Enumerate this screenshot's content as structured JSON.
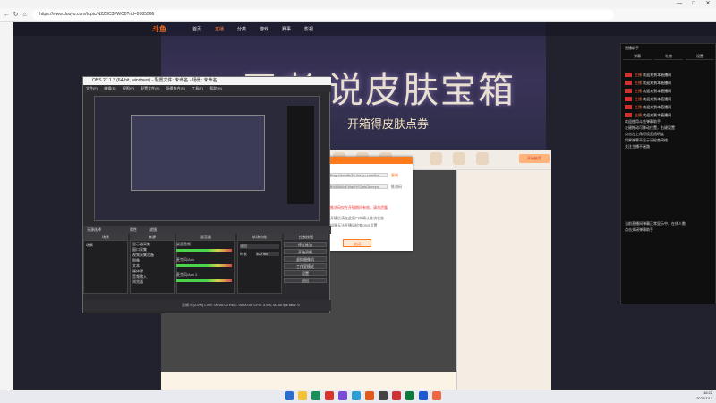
{
  "browser": {
    "url": "https://www.douyu.com/topic/N2Z3C3FWC0?rid=9985566",
    "window_controls": [
      "—",
      "□",
      "✕"
    ],
    "nav_icons": [
      "back-icon",
      "refresh-icon",
      "home-icon"
    ]
  },
  "site": {
    "logo": "斗鱼",
    "nav": [
      "首页",
      "直播",
      "分类",
      "游戏",
      "赛事",
      "影视"
    ],
    "hero_title": "王者 说皮肤宝箱",
    "hero_subtitle": "开箱得皮肤点券",
    "orange_button": "开始抽奖"
  },
  "dialog": {
    "lines": [
      "rtmp://sendtc3a.douyu.com/live",
      "9985566rEI9aMVS3ekDkmrzo",
      "推流码",
      "复制"
    ],
    "warning": "推流码仅在开播期间有效，请勿泄露",
    "note1": "开播后请在此窗口中确认推流状态",
    "note2": "如果无法开播请检查OBS设置",
    "button": "关闭"
  },
  "obs": {
    "title": "OBS 27.1.3 (64-bit, windows) - 配置文件: 未命名 - 场景: 未命名",
    "menu": [
      "文件(F)",
      "编辑(E)",
      "视图(V)",
      "配置文件(P)",
      "场景集合(S)",
      "工具(T)",
      "帮助(H)"
    ],
    "tabs": [
      "无源选择",
      "属性",
      "滤镜"
    ],
    "panes": [
      "场景",
      "来源",
      "混音器",
      "转场特效",
      "控制按钮"
    ],
    "scene": "场景",
    "sources": [
      "显示器采集",
      "窗口采集",
      "视频采集设备",
      "图像",
      "文本",
      "媒体源",
      "音频输入",
      "浏览器"
    ],
    "mixer": [
      "桌面音频",
      "麦克风/Aux",
      "麦克风/Aux 2"
    ],
    "transition": [
      "淡出",
      "时长",
      "300 ms"
    ],
    "controls": [
      "停止推流",
      "开始录制",
      "虚拟摄像机",
      "工作室模式",
      "设置",
      "退出"
    ],
    "status": "丢帧 0 (0.0%)   LIVE: 00:00:00   REC: 00:00:00   CPU: 3.9%, 60.00 fps   kb/s: 0"
  },
  "overlay": {
    "title": "直播助手",
    "tabs": [
      "弹幕",
      "礼物",
      "设置"
    ],
    "messages": [
      {
        "name": "主播",
        "text": "欢迎来到本直播间"
      },
      {
        "name": "主播",
        "text": "欢迎来到本直播间"
      },
      {
        "name": "主播",
        "text": "欢迎来到本直播间"
      },
      {
        "name": "主播",
        "text": "欢迎来到本直播间"
      },
      {
        "name": "主播",
        "text": "欢迎来到本直播间"
      },
      {
        "name": "主播",
        "text": "欢迎来到本直播间"
      }
    ],
    "notes": [
      "欢迎使用斗鱼弹幕助手",
      "左键拖动可移动位置，右键设置",
      "点击左上角可设置透明度",
      "如果弹幕不显示请检查网络",
      "关注主播不迷路"
    ],
    "footer": [
      "当前直播间弹幕正常显示中，在线人数",
      "点击关闭弹幕助手"
    ]
  },
  "taskbar": {
    "time": "16:22",
    "date": "2022/7/14",
    "icon_colors": [
      "#2b6ccf",
      "#f2c233",
      "#1a8f5c",
      "#d9342b",
      "#7a4bd6",
      "#2b9fd6",
      "#e05a1a",
      "#444444",
      "#c33",
      "#0a7a3a",
      "#1d5ad1",
      "#e64",
      "#555"
    ]
  }
}
